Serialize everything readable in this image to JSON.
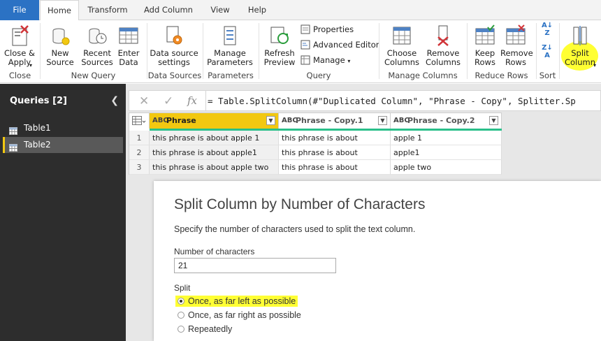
{
  "tabs": [
    "File",
    "Home",
    "Transform",
    "Add Column",
    "View",
    "Help"
  ],
  "ribbon": {
    "close_apply": "Close &\nApply",
    "new_source": "New\nSource",
    "recent_sources": "Recent\nSources",
    "enter_data": "Enter\nData",
    "data_source_settings": "Data source\nsettings",
    "manage_parameters": "Manage\nParameters",
    "refresh_preview": "Refresh\nPreview",
    "properties": "Properties",
    "advanced_editor": "Advanced Editor",
    "manage": "Manage",
    "choose_columns": "Choose\nColumns",
    "remove_columns": "Remove\nColumns",
    "keep_rows": "Keep\nRows",
    "remove_rows": "Remove\nRows",
    "split_column": "Split\nColumn",
    "groups": [
      "Close",
      "New Query",
      "Data Sources",
      "Parameters",
      "Query",
      "Manage Columns",
      "Reduce Rows",
      "Sort"
    ]
  },
  "queries": {
    "header": "Queries [2]",
    "items": [
      "Table1",
      "Table2"
    ],
    "selected": "Table2"
  },
  "formula": "= Table.SplitColumn(#\"Duplicated Column\", \"Phrase - Copy\", Splitter.Sp",
  "grid": {
    "type_label": "ABC",
    "columns": [
      "Phrase",
      "Phrase - Copy.1",
      "Phrase - Copy.2"
    ],
    "rows": [
      [
        "1",
        "this phrase is about apple 1",
        "this phrase is about",
        "apple 1"
      ],
      [
        "2",
        "this phrase is about apple1",
        "this phrase is about",
        "apple1"
      ],
      [
        "3",
        "this phrase is about apple two",
        "this phrase is about",
        "apple two"
      ]
    ]
  },
  "dialog": {
    "title": "Split Column by Number of Characters",
    "subtitle": "Specify the number of characters used to split the text column.",
    "num_label": "Number of characters",
    "num_value": "21",
    "split_label": "Split",
    "options": [
      "Once, as far left as possible",
      "Once, as far right as possible",
      "Repeatedly"
    ],
    "selected": 0
  },
  "colors": {
    "file_tab": "#2b72c4",
    "highlight": "#ffff33",
    "selected_header": "#f2c811",
    "accent_green": "#2abf8a"
  }
}
